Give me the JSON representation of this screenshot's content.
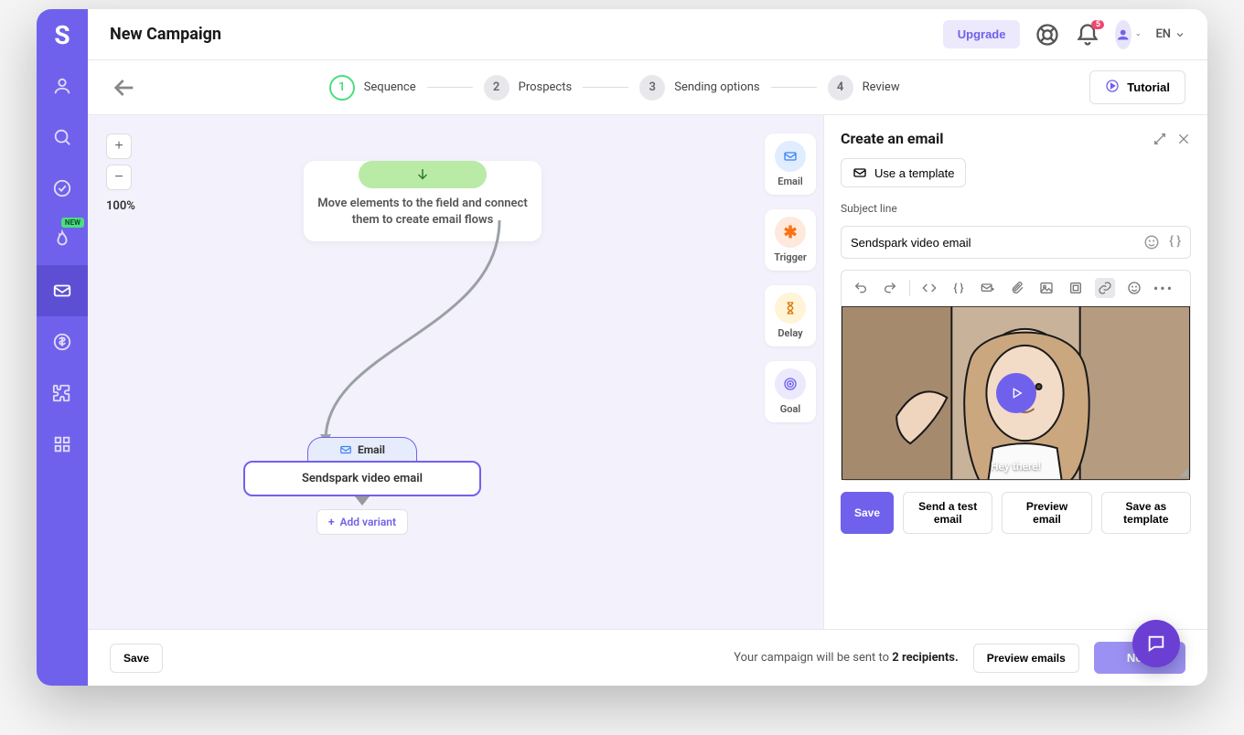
{
  "header": {
    "title": "New Campaign",
    "upgrade": "Upgrade",
    "notification_count": "5",
    "lang": "EN"
  },
  "stepper": {
    "steps": [
      {
        "num": "1",
        "label": "Sequence"
      },
      {
        "num": "2",
        "label": "Prospects"
      },
      {
        "num": "3",
        "label": "Sending options"
      },
      {
        "num": "4",
        "label": "Review"
      }
    ],
    "tutorial": "Tutorial"
  },
  "canvas": {
    "zoom": "100%",
    "hint": "Move elements to the field and connect them to create email flows",
    "node": {
      "type_label": "Email",
      "title": "Sendspark video email",
      "add_variant": "Add variant"
    }
  },
  "palette": {
    "items": [
      {
        "label": "Email"
      },
      {
        "label": "Trigger"
      },
      {
        "label": "Delay"
      },
      {
        "label": "Goal"
      }
    ]
  },
  "panel": {
    "title": "Create an email",
    "use_template": "Use a template",
    "subject_label": "Subject line",
    "subject_value": "Sendspark video email",
    "video_caption": "Hey there!",
    "actions": {
      "save": "Save",
      "send_test": "Send a test email",
      "preview": "Preview email",
      "save_template": "Save as template"
    }
  },
  "footer": {
    "save": "Save",
    "sent_to_prefix": "Your campaign will be sent to ",
    "sent_to_bold": "2 recipients.",
    "preview": "Preview emails",
    "next": "Next"
  },
  "sidebar": {
    "new_badge": "NEW"
  }
}
